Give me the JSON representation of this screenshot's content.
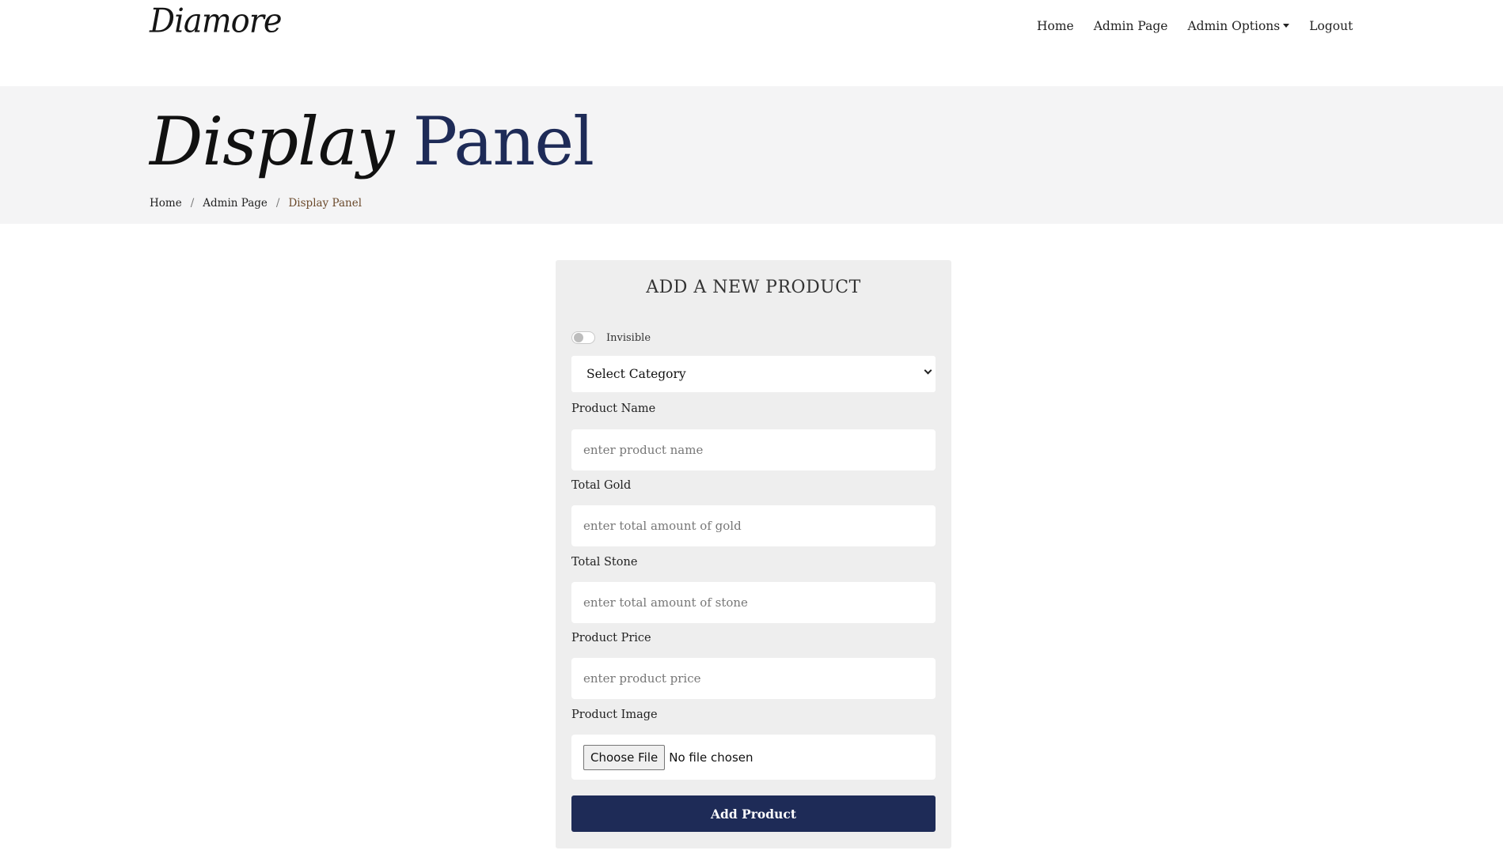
{
  "brand": {
    "logo_text": "Diamore"
  },
  "nav": {
    "home": "Home",
    "admin_page": "Admin Page",
    "admin_options": "Admin Options",
    "logout": "Logout"
  },
  "hero": {
    "title_word1": "Display",
    "title_word2": "Panel",
    "breadcrumb": {
      "home": "Home",
      "separator": "/",
      "admin_page": "Admin Page",
      "current": "Display Panel"
    }
  },
  "form": {
    "title": "ADD A NEW PRODUCT",
    "visibility_toggle": {
      "label": "Invisible",
      "checked": false
    },
    "category_select": {
      "selected": "Select Category"
    },
    "fields": [
      {
        "label": "Product Name",
        "placeholder": "enter product name"
      },
      {
        "label": "Total Gold",
        "placeholder": "enter total amount of gold"
      },
      {
        "label": "Total Stone",
        "placeholder": "enter total amount of stone"
      },
      {
        "label": "Product Price",
        "placeholder": "enter product price"
      }
    ],
    "image": {
      "label": "Product Image",
      "button": "Choose File",
      "status": "No file chosen"
    },
    "submit": "Add Product"
  },
  "colors": {
    "primary": "#1e2b57",
    "hero_bg": "#f4f4f5",
    "card_bg": "#eeeeee",
    "breadcrumb_active": "#6b4a2c"
  }
}
